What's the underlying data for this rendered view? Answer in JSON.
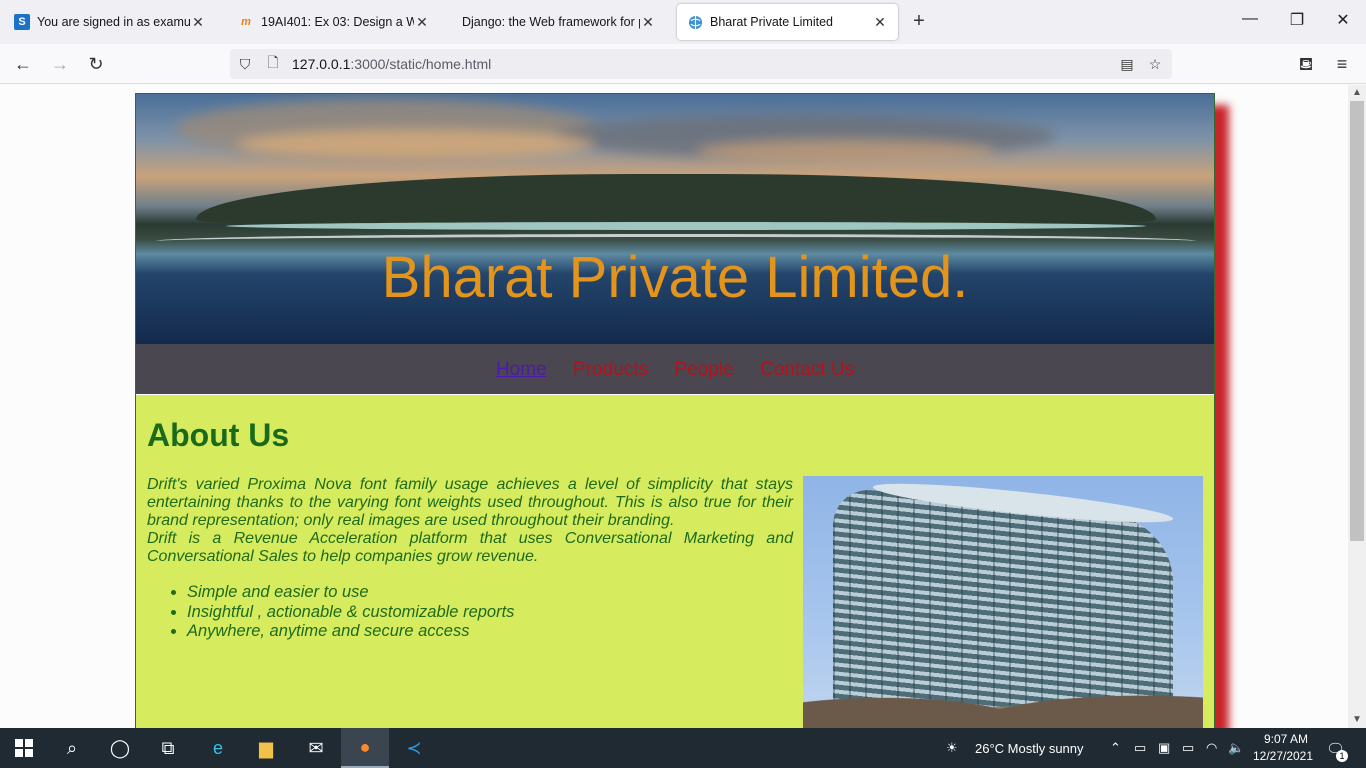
{
  "browser": {
    "tabs": [
      {
        "title": "You are signed in as examuser1",
        "favicon": "S"
      },
      {
        "title": "19AI401: Ex 03: Design a Websit",
        "favicon": "m"
      },
      {
        "title": "Django: the Web framework for perf",
        "favicon": ""
      },
      {
        "title": "Bharat Private Limited",
        "favicon": "globe"
      }
    ],
    "url_host": "127.0.0.1",
    "url_rest": ":3000/static/home.html"
  },
  "site": {
    "title": "Bharat Private Limited.",
    "nav": [
      "Home",
      "Products",
      "People",
      "Contact Us"
    ],
    "heading": "About Us",
    "para1": "Drift's varied Proxima Nova font family usage achieves a level of simplicity that stays entertaining thanks to the varying font weights used throughout. This is also true for their brand representation; only real images are used throughout their branding.",
    "para2": "Drift is a Revenue Acceleration platform that uses Conversational Marketing and Conversational Sales to help companies grow revenue.",
    "features": [
      "Simple and easier to use",
      "Insightful , actionable & customizable reports",
      "Anywhere, anytime and secure access"
    ]
  },
  "taskbar": {
    "weather": "26°C  Mostly sunny",
    "time": "9:07 AM",
    "date": "12/27/2021",
    "notification_count": "1"
  },
  "colors": {
    "hero_title": "#e3941c",
    "nav_bg": "#4b4750",
    "nav_link": "#b8101a",
    "content_bg": "#d6eb5d",
    "content_text": "#1e6b1e",
    "shadow": "#c8252a"
  }
}
